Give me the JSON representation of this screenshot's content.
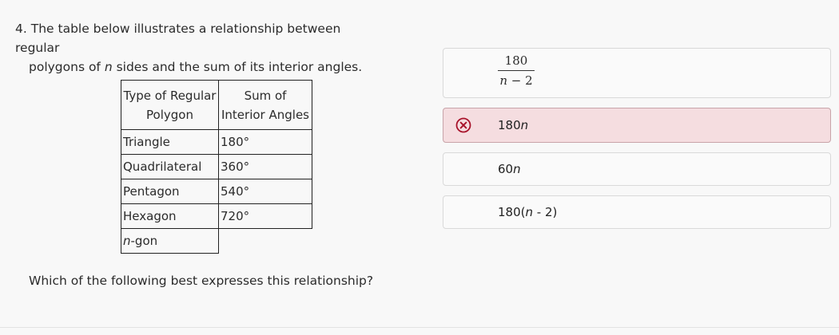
{
  "question": {
    "number": "4.",
    "line1": "The table below illustrates a relationship between regular",
    "line2_pre": "polygons of ",
    "line2_var": "n",
    "line2_post": " sides and the sum of its interior angles.",
    "prompt": "Which of the following best expresses this relationship?"
  },
  "table": {
    "headers": [
      "Type of Regular Polygon",
      "Sum of Interior Angles"
    ],
    "rows": [
      {
        "polygon": "Triangle",
        "sum": "180°"
      },
      {
        "polygon": "Quadrilateral",
        "sum": "360°"
      },
      {
        "polygon": "Pentagon",
        "sum": "540°"
      },
      {
        "polygon": "Hexagon",
        "sum": "720°"
      }
    ],
    "last_row": {
      "var": "n",
      "suffix": "-gon"
    }
  },
  "choices": {
    "a": {
      "numerator": "180",
      "denominator_var": "n",
      "denominator_rest": " − 2"
    },
    "b": {
      "coef": "180",
      "var": "n",
      "state": "incorrect"
    },
    "c": {
      "coef": "60",
      "var": "n"
    },
    "d": {
      "pre": "180(",
      "var": "n",
      "post": " - 2)"
    }
  },
  "colors": {
    "wrong_bg": "#f5dde0",
    "wrong_border": "#c8a4a9",
    "wrong_icon": "#a8122a"
  },
  "icons": {
    "wrong": "x-circle-icon"
  }
}
